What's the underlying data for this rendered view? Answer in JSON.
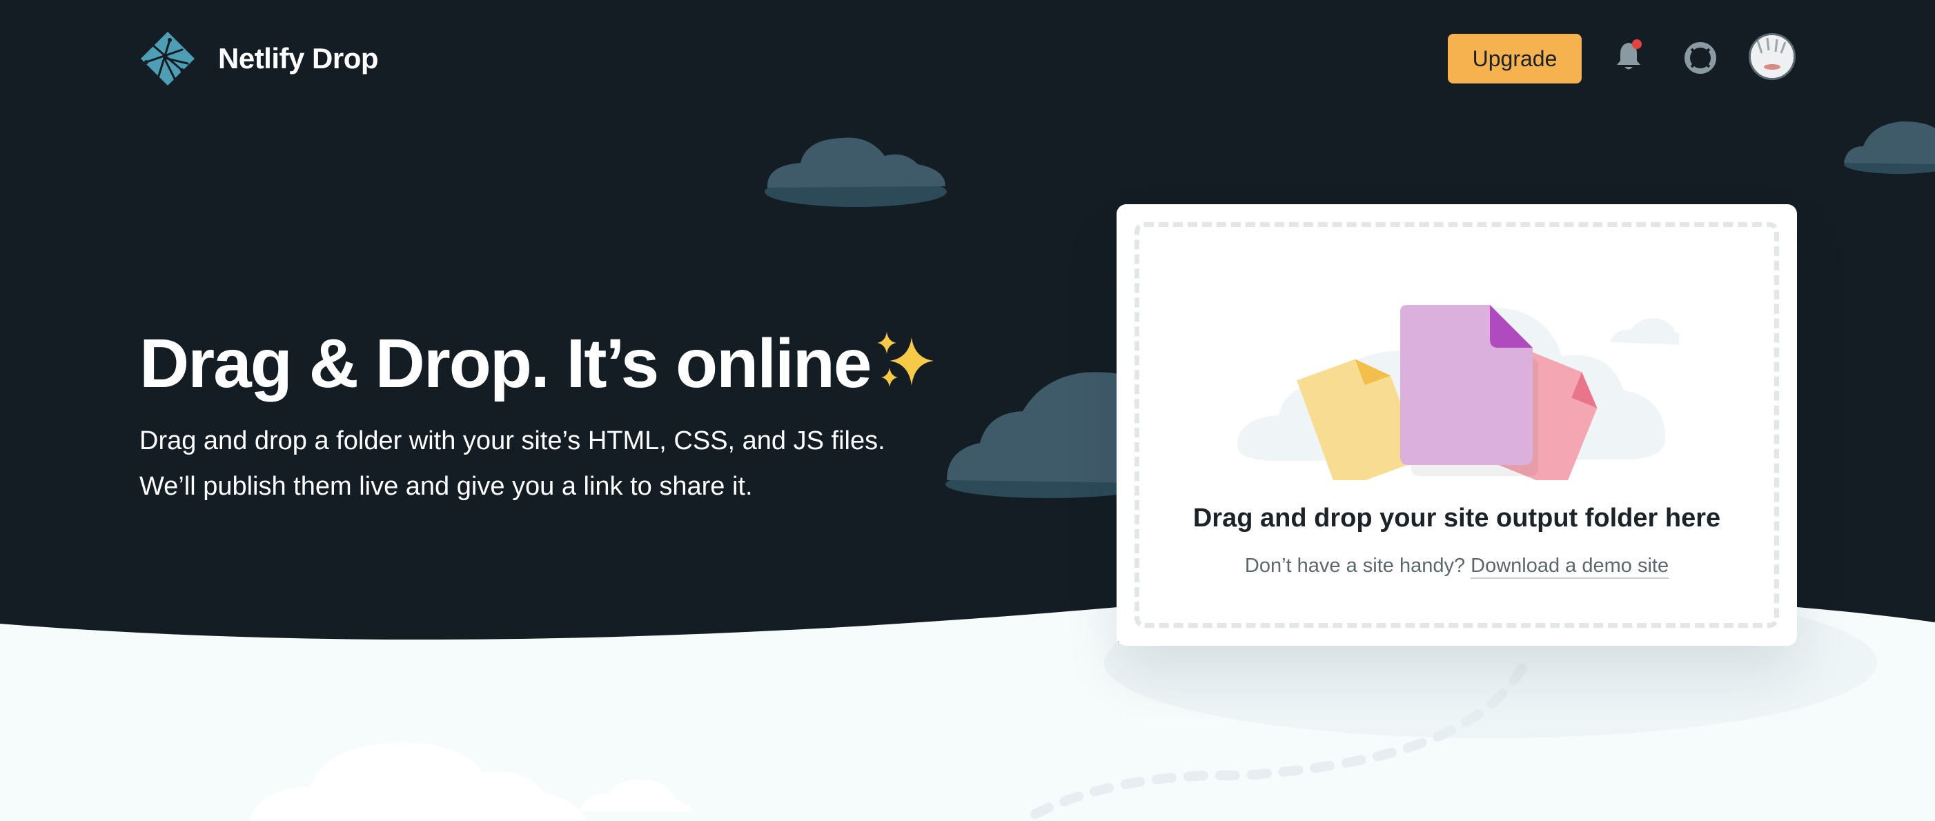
{
  "brand": {
    "name": "Netlify Drop",
    "logo_icon": "netlify-logo-icon"
  },
  "header": {
    "upgrade_label": "Upgrade",
    "notifications_icon": "bell-icon",
    "help_icon": "lifebuoy-icon",
    "avatar_icon": "user-avatar"
  },
  "hero": {
    "title": "Drag & Drop. It’s online",
    "title_emoji_icon": "sparkles-icon",
    "subtitle_line1": "Drag and drop a folder with your site’s HTML, CSS, and JS files.",
    "subtitle_line2": "We’ll publish them live and give you a link to share it."
  },
  "dropzone": {
    "title": "Drag and drop your site output folder here",
    "help_text": "Don’t have a site handy?",
    "demo_link": "Download a demo site"
  },
  "colors": {
    "background_dark": "#131d23",
    "background_light": "#f6fbfc",
    "accent_upgrade": "#f6b24f",
    "cloud": "#3f5a69",
    "notification_dot": "#e3443f"
  }
}
